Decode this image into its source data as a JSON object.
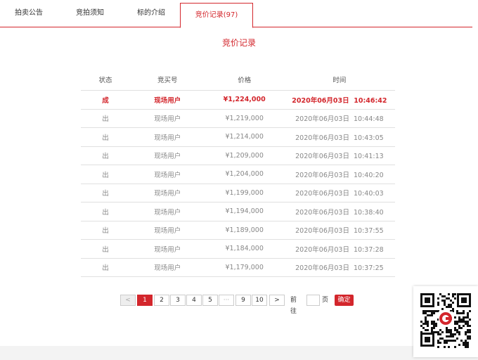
{
  "tabs": [
    {
      "label": "拍卖公告"
    },
    {
      "label": "竞拍须知"
    },
    {
      "label": "标的介绍"
    },
    {
      "label": "竞价记录(97)"
    }
  ],
  "section_title": "竞价记录",
  "table": {
    "headers": [
      "状态",
      "竞买号",
      "价格",
      "时间"
    ],
    "rows": [
      {
        "status": "成",
        "bidder": "现场用户",
        "price": "¥1,224,000",
        "time": "2020年06月03日  10:46:42"
      },
      {
        "status": "出",
        "bidder": "现场用户",
        "price": "¥1,219,000",
        "time": "2020年06月03日  10:44:48"
      },
      {
        "status": "出",
        "bidder": "现场用户",
        "price": "¥1,214,000",
        "time": "2020年06月03日  10:43:05"
      },
      {
        "status": "出",
        "bidder": "现场用户",
        "price": "¥1,209,000",
        "time": "2020年06月03日  10:41:13"
      },
      {
        "status": "出",
        "bidder": "现场用户",
        "price": "¥1,204,000",
        "time": "2020年06月03日  10:40:20"
      },
      {
        "status": "出",
        "bidder": "现场用户",
        "price": "¥1,199,000",
        "time": "2020年06月03日  10:40:03"
      },
      {
        "status": "出",
        "bidder": "现场用户",
        "price": "¥1,194,000",
        "time": "2020年06月03日  10:38:40"
      },
      {
        "status": "出",
        "bidder": "现场用户",
        "price": "¥1,189,000",
        "time": "2020年06月03日  10:37:55"
      },
      {
        "status": "出",
        "bidder": "现场用户",
        "price": "¥1,184,000",
        "time": "2020年06月03日  10:37:28"
      },
      {
        "status": "出",
        "bidder": "现场用户",
        "price": "¥1,179,000",
        "time": "2020年06月03日  10:37:25"
      }
    ]
  },
  "pagination": {
    "prev": "<",
    "pages": [
      "1",
      "2",
      "3",
      "4",
      "5"
    ],
    "ellipsis": "···",
    "tail_pages": [
      "9",
      "10"
    ],
    "next": ">",
    "goto_label": "前往",
    "page_label": "页",
    "confirm_label": "确定"
  },
  "colors": {
    "accent": "#d3262c"
  }
}
